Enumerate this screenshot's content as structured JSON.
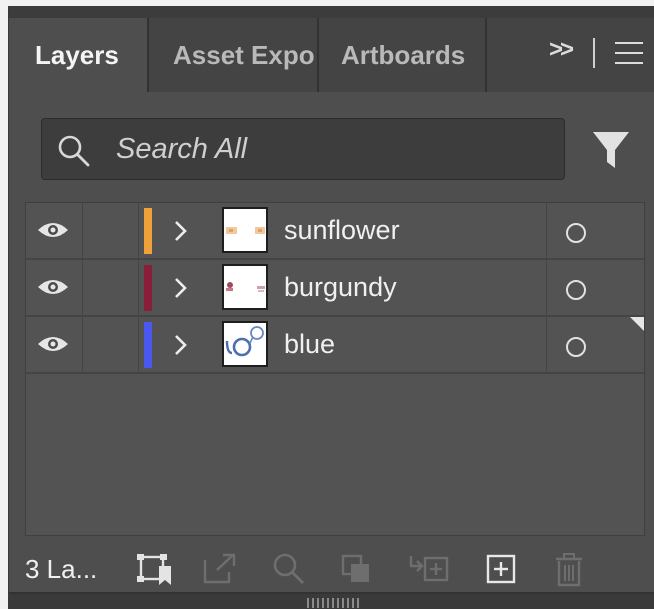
{
  "tabs": [
    {
      "label": "Layers",
      "active": true
    },
    {
      "label": "Asset Expo",
      "active": false
    },
    {
      "label": "Artboards",
      "active": false
    }
  ],
  "tab_overflow_label": ">>",
  "search": {
    "placeholder": "Search All",
    "value": ""
  },
  "layers": [
    {
      "name": "sunflower",
      "color": "#f0a23a",
      "visible": true,
      "expanded": false
    },
    {
      "name": "burgundy",
      "color": "#8a1e3a",
      "visible": true,
      "expanded": false
    },
    {
      "name": "blue",
      "color": "#4b58f0",
      "visible": true,
      "expanded": false
    }
  ],
  "footer": {
    "layer_count": "3 La...",
    "buttons": [
      "collect-for-export-icon",
      "export-icon",
      "locate-object-icon",
      "make-clipping-mask-icon",
      "create-sublayer-icon",
      "create-new-layer-icon",
      "delete-icon"
    ]
  },
  "colors": {
    "panel_bg": "#4e4e4e",
    "tabbar_bg": "#3c3c3c",
    "text": "#f0f0f0"
  }
}
